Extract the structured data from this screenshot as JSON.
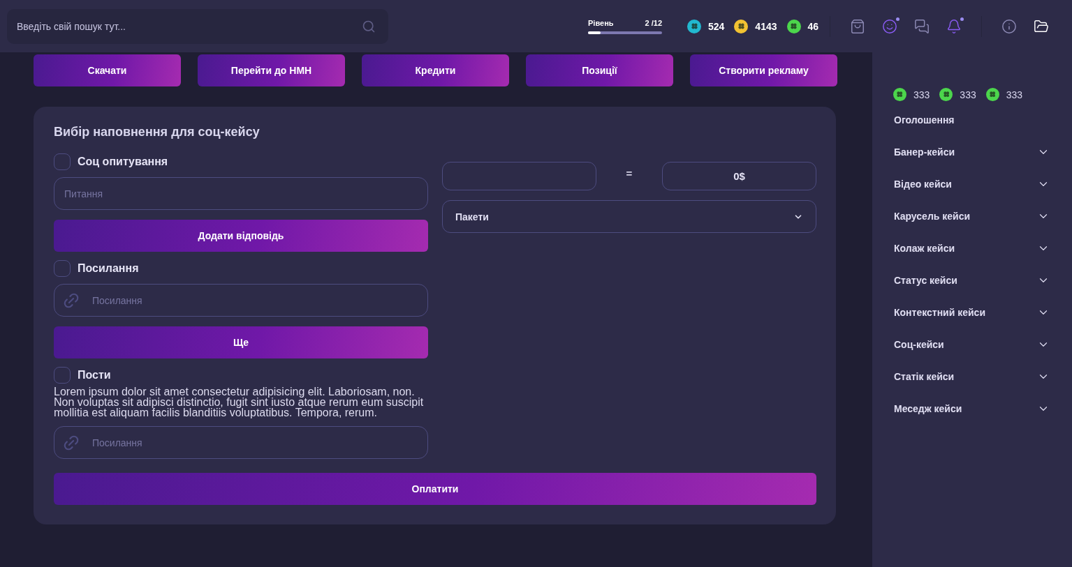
{
  "search": {
    "placeholder": "Введіть свій пошук тут..."
  },
  "level": {
    "label": "Рівень",
    "value": "2 /12",
    "level": 0.17
  },
  "currencies": [
    {
      "amount": "524",
      "color": "#22b8cf"
    },
    {
      "amount": "4143",
      "color": "#f2c232"
    },
    {
      "amount": "46",
      "color": "#4cd64c"
    }
  ],
  "header_icons": [
    {
      "kind": "bag",
      "dot": false,
      "active": false
    },
    {
      "kind": "smile",
      "dot": true,
      "active": true
    },
    {
      "kind": "chat",
      "dot": false,
      "active": false
    },
    {
      "kind": "bell",
      "dot": true,
      "active": true
    },
    {
      "kind": "info",
      "dot": false,
      "active": false
    },
    {
      "kind": "folder",
      "dot": false,
      "active": true
    }
  ],
  "action_buttons": [
    "Скачати",
    "Перейти до НМН",
    "Кредити",
    "Позиції",
    "Створити рекламу"
  ],
  "card": {
    "title": "Вибір наповнення для соц-кейсу",
    "sections": [
      {
        "kind": "poll",
        "label": "Соц опитування",
        "checked": false,
        "placeholder": "Питання",
        "button": "Додати відповідь"
      },
      {
        "kind": "link",
        "label": "Посилання",
        "checked": false,
        "placeholder": "Посилання",
        "button": "Ще"
      },
      {
        "kind": "posts",
        "label": "Пости",
        "checked": false,
        "text": "Lorem ipsum dolor sit amet consectetur adipisicing elit. Laboriosam, non. Non voluptas sit adipisci distinctio, fugit sint iusto atque rerum eum suscipit mollitia est aliquam facilis blanditiis voluptatibus. Tempora, rerum.",
        "placeholder": "Посилання"
      }
    ],
    "equals": "=",
    "total": "0$",
    "select": "Пакети",
    "pay_button": "Оплатити"
  },
  "sidebar": {
    "balances": [
      {
        "amount": "333",
        "color": "#4cd64c"
      },
      {
        "amount": "333",
        "color": "#4cd64c"
      },
      {
        "amount": "333",
        "color": "#4cd64c"
      }
    ],
    "items": [
      {
        "label": "Оголошення",
        "kind": "link"
      },
      {
        "label": "Банер-кейси",
        "kind": "group",
        "expanded": false
      },
      {
        "label": "Відео кейси",
        "kind": "group",
        "expanded": false
      },
      {
        "label": "Карусель кейси",
        "kind": "group",
        "expanded": false
      },
      {
        "label": "Колаж кейси",
        "kind": "group",
        "expanded": false
      },
      {
        "label": "Статус кейси",
        "kind": "group",
        "expanded": false
      },
      {
        "label": "Контекстний кейси",
        "kind": "group",
        "expanded": false
      },
      {
        "label": "Соц-кейси",
        "kind": "group",
        "expanded": false
      },
      {
        "label": "Статік кейси",
        "kind": "group",
        "expanded": false
      },
      {
        "label": "Меседж кейси",
        "kind": "group",
        "expanded": false
      }
    ]
  }
}
